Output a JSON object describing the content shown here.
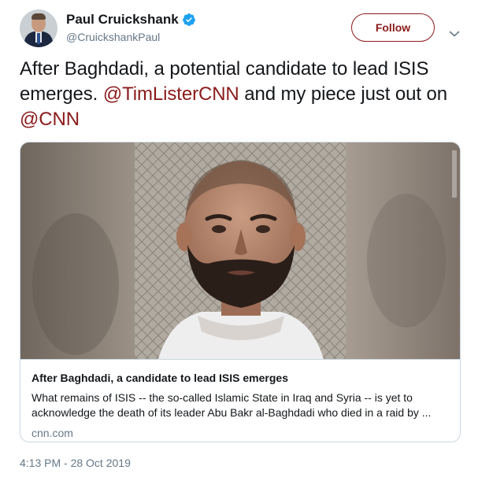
{
  "author": {
    "display_name": "Paul Cruickshank",
    "handle": "@CruickshankPaul",
    "verified": true
  },
  "follow_button": {
    "label": "Follow"
  },
  "tweet": {
    "text_before": "After Baghdadi, a potential candidate to lead ISIS emerges. ",
    "mention_1": "@TimListerCNN",
    "text_middle": " and my piece just out on ",
    "mention_2": "@CNN"
  },
  "card": {
    "title": "After Baghdadi, a candidate to lead ISIS emerges",
    "description": "What remains of ISIS -- the so-called Islamic State in Iraq and Syria -- is yet to acknowledge the death of its leader Abu Bakr al-Baghdadi who died in a raid by ...",
    "domain": "cnn.com"
  },
  "timestamp": "4:13 PM - 28 Oct 2019",
  "colors": {
    "accent": "#8b1a1a",
    "verified": "#1da1f2",
    "secondary_text": "#657786",
    "border": "#ccd6dd"
  }
}
